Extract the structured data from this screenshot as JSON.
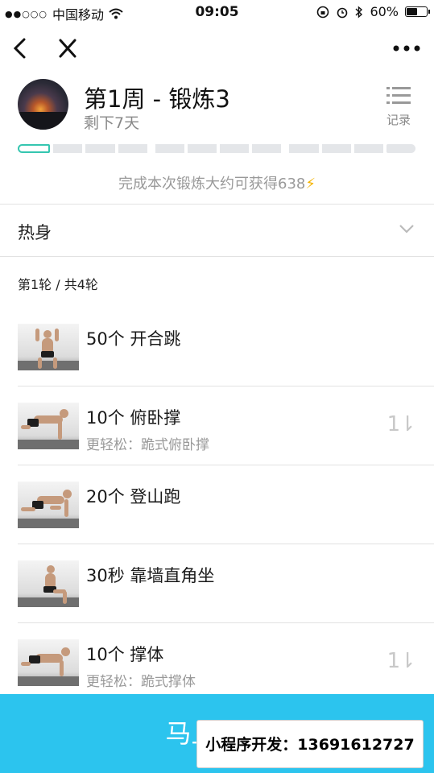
{
  "status_bar": {
    "signal": "●●○○○",
    "carrier": "中国移动",
    "time": "09:05",
    "battery": "60%",
    "battery_level": 0.6
  },
  "nav": {
    "back_icon": "chevron-left-icon",
    "close_icon": "close-icon",
    "more_icon": "more-dots-icon"
  },
  "header": {
    "title": "第1周 - 锻炼3",
    "subtitle": "剩下7天",
    "record_label": "记录"
  },
  "progress": {
    "completed": 1,
    "total": 12
  },
  "reward": {
    "text": "完成本次锻炼大约可获得638",
    "icon": "⚡"
  },
  "section": {
    "label": "热身",
    "icon": "chevron-down-icon"
  },
  "round_label": "第1轮 / 共4轮",
  "exercises": [
    {
      "name": "50个 开合跳",
      "alt": ""
    },
    {
      "name": "10个 俯卧撑",
      "alt": "更轻松：跪式俯卧撑",
      "swap": "1⇂"
    },
    {
      "name": "20个 登山跑",
      "alt": ""
    },
    {
      "name": "30秒 靠墙直角坐",
      "alt": ""
    },
    {
      "name": "10个 撑体",
      "alt": "更轻松：跪式撑体",
      "swap": "1⇂"
    }
  ],
  "bottom": {
    "start_label": "马上开始",
    "overlay_text": "小程序开发：13691612727"
  },
  "colors": {
    "accent": "#2cc4ee",
    "progress_accent": "#35c6b0",
    "bolt": "#f5b400"
  }
}
